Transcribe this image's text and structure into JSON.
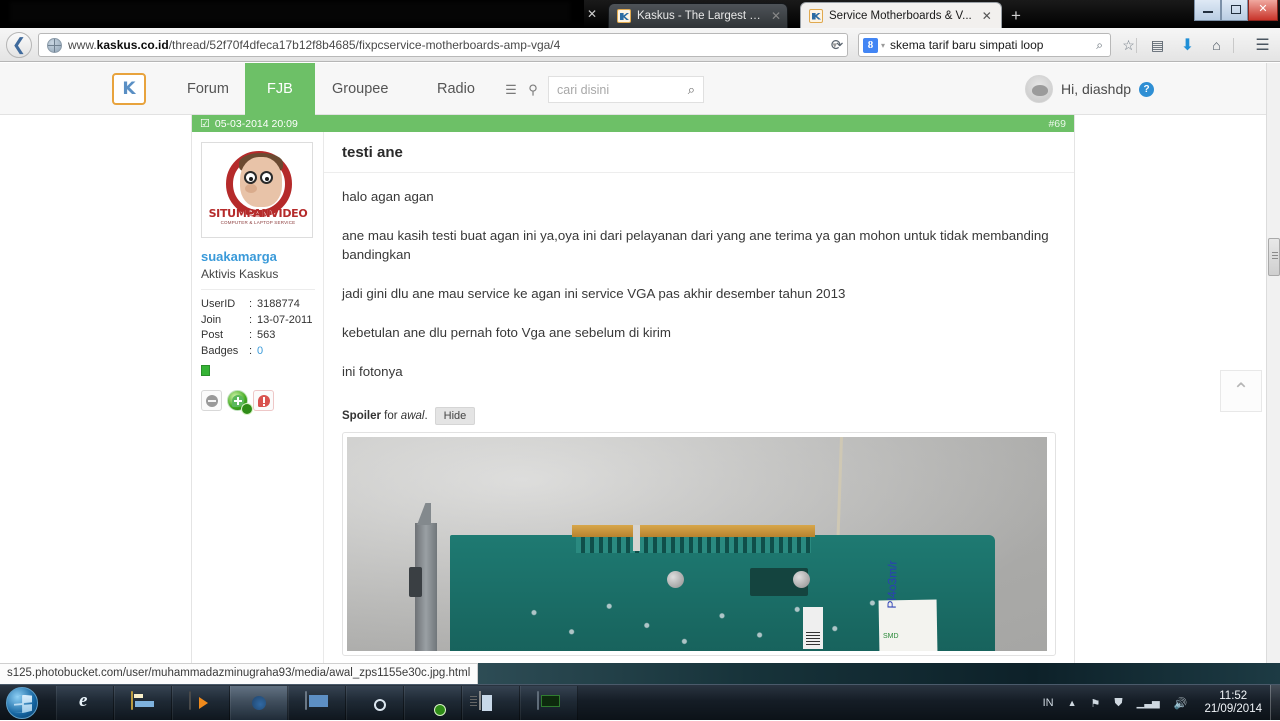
{
  "window": {
    "controls": {
      "minimize": "–",
      "maximize": "❐",
      "close": "✕"
    }
  },
  "browser": {
    "tabs": [
      {
        "title": "Kaskus - The Largest Indon...",
        "active": false,
        "close": "✕"
      },
      {
        "title": "Service Motherboards & V...",
        "active": true,
        "close": "✕"
      }
    ],
    "lone_tab_close": "✕",
    "new_tab_label": "+",
    "back_icon": "❮",
    "url_prefix": "www.",
    "url_domain": "kaskus.co.id",
    "url_path": "/thread/52f70f4dfeca17b12f8b4685/fixpcservice-motherboards-amp-vga/4",
    "url_dropdown_icon": "▾",
    "reload_icon": "⟳",
    "search_engine_letter": "8",
    "search_engine_caret": "▾",
    "search_value": "skema tarif baru simpati loop",
    "search_magnifier": "⌕",
    "toolbar_icons": {
      "bookmark": "☆",
      "reader": "▤",
      "downloads": "⬇",
      "home": "⌂",
      "menu": "☰"
    }
  },
  "site": {
    "logo_glyph": "K",
    "nav": [
      {
        "label": "Forum",
        "active": false
      },
      {
        "label": "FJB",
        "active": true
      },
      {
        "label": "Groupee",
        "active": false
      },
      {
        "label": "Radio",
        "active": false
      }
    ],
    "list_icon": "☰",
    "pin_icon": "⚲",
    "search_placeholder": "cari disini",
    "search_magnifier": "⌕",
    "greeting": "Hi, diashdp",
    "help_glyph": "?",
    "accent_green": "#6dc067",
    "accent_blue": "#3a9ad9"
  },
  "post": {
    "checkbox_icon": "☑",
    "timestamp": "05-03-2014 20:09",
    "number": "#69",
    "title": "testi ane",
    "paragraphs": [
      "halo agan agan",
      "ane mau kasih testi buat agan ini ya,oya ini dari pelayanan dari yang ane terima ya gan mohon untuk tidak membanding bandingkan",
      "jadi gini dlu ane mau service ke agan ini service VGA pas akhir desember tahun 2013",
      "kebetulan ane dlu pernah foto Vga ane sebelum di kirim",
      "ini fotonya"
    ],
    "spoiler": {
      "word": "Spoiler",
      "for": " for ",
      "name": "awal",
      "punct": ".",
      "hide_label": "Hide"
    },
    "photo": {
      "alt": "vga-card-photo",
      "sticky_note_text": "Pl4o3m/r",
      "smd_text": "SMD"
    }
  },
  "user": {
    "avatar_wordmark": "SITUMPANVIDEO",
    "avatar_subline": "COMPUTER & LAPTOP SERVICE",
    "name": "suakamarga",
    "rank": "Aktivis Kaskus",
    "stats": [
      {
        "key": "UserID",
        "sep": ":",
        "value": "3188774"
      },
      {
        "key": "Join",
        "sep": ":",
        "value": "13-07-2011"
      },
      {
        "key": "Post",
        "sep": ":",
        "value": "563"
      },
      {
        "key": "Badges",
        "sep": ":",
        "value": "0"
      }
    ],
    "buttons": [
      {
        "name": "neutral-reputation-button"
      },
      {
        "name": "give-reputation-button"
      },
      {
        "name": "report-post-button"
      }
    ]
  },
  "rail": {
    "scroll_to_top_icon": "⌃"
  },
  "statusbar": {
    "link_url": "s125.photobucket.com/user/muhammadazminugraha93/media/awal_zps1155e30c.jpg.html"
  },
  "taskbar": {
    "start_label": "start-orb",
    "items": [
      {
        "name": "internet-explorer",
        "state": "dim"
      },
      {
        "name": "windows-explorer",
        "state": "dim"
      },
      {
        "name": "media-player",
        "state": "dim"
      },
      {
        "name": "firefox",
        "state": "on"
      },
      {
        "name": "display-settings",
        "state": "dim"
      },
      {
        "name": "steam",
        "state": "dim"
      },
      {
        "name": "green-app",
        "state": "dim"
      },
      {
        "name": "document-viewer",
        "state": "dim"
      },
      {
        "name": "system-monitor",
        "state": "dim"
      }
    ],
    "tray": {
      "language": "IN",
      "show_hidden": "▲",
      "flag": "⚑",
      "action_center": "⛊",
      "network": "▁▃▅",
      "volume": "🔊",
      "time": "11:52",
      "date": "21/09/2014"
    }
  }
}
